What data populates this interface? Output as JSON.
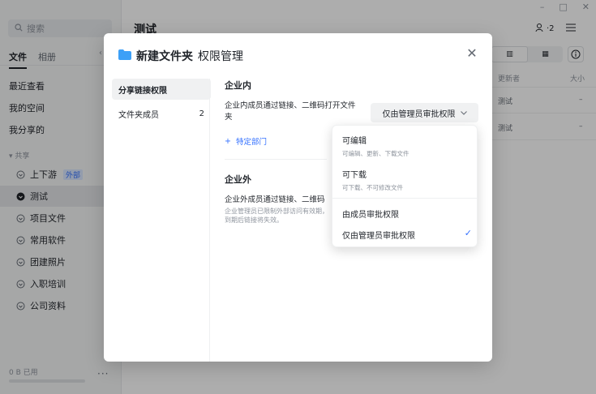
{
  "window": {
    "minimize": "–",
    "maximize": "□",
    "close": "✕"
  },
  "sidebar": {
    "search_placeholder": "搜索",
    "tabs": [
      {
        "label": "文件"
      },
      {
        "label": "相册"
      }
    ],
    "nav": [
      {
        "label": "最近查看"
      },
      {
        "label": "我的空间"
      },
      {
        "label": "我分享的"
      }
    ],
    "section_label": "▾ 共享",
    "tree": [
      {
        "label": "上下游",
        "badge": "外部"
      },
      {
        "label": "测试"
      },
      {
        "label": "项目文件"
      },
      {
        "label": "常用软件"
      },
      {
        "label": "团建照片"
      },
      {
        "label": "入职培训"
      },
      {
        "label": "公司资料"
      }
    ],
    "storage": {
      "label": "0 B 已用",
      "fraction": 0.0
    },
    "more": "···"
  },
  "main": {
    "title": "测试",
    "members_count": "·2",
    "columns": {
      "updater": "更新者",
      "size": "大小"
    },
    "rows": [
      {
        "updater": "测试",
        "size": "–"
      },
      {
        "updater": "测试",
        "size": "–"
      }
    ]
  },
  "modal": {
    "folder_name": "新建文件夹",
    "subtitle": "权限管理",
    "close": "✕",
    "nav": [
      {
        "label": "分享链接权限",
        "count": ""
      },
      {
        "label": "文件夹成员",
        "count": "2"
      }
    ],
    "internal": {
      "title": "企业内",
      "desc": "企业内成员通过链接、二维码打开文件夹",
      "select_value": "仅由管理员审批权限",
      "dept_label": "特定部门"
    },
    "external": {
      "title": "企业外",
      "desc": "企业外成员通过链接、二维码",
      "note": "企业管理员已限制外部访问有效期，到期后链接将失效。"
    }
  },
  "dropdown": {
    "options": [
      {
        "title": "可编辑",
        "desc": "可编辑、更新、下载文件"
      },
      {
        "title": "可下载",
        "desc": "可下载、不可修改文件"
      },
      {
        "title": "由成员审批权限"
      },
      {
        "title": "仅由管理员审批权限",
        "checked": true
      }
    ]
  },
  "colors": {
    "accent": "#3370ff",
    "folder": "#3da0f7"
  }
}
